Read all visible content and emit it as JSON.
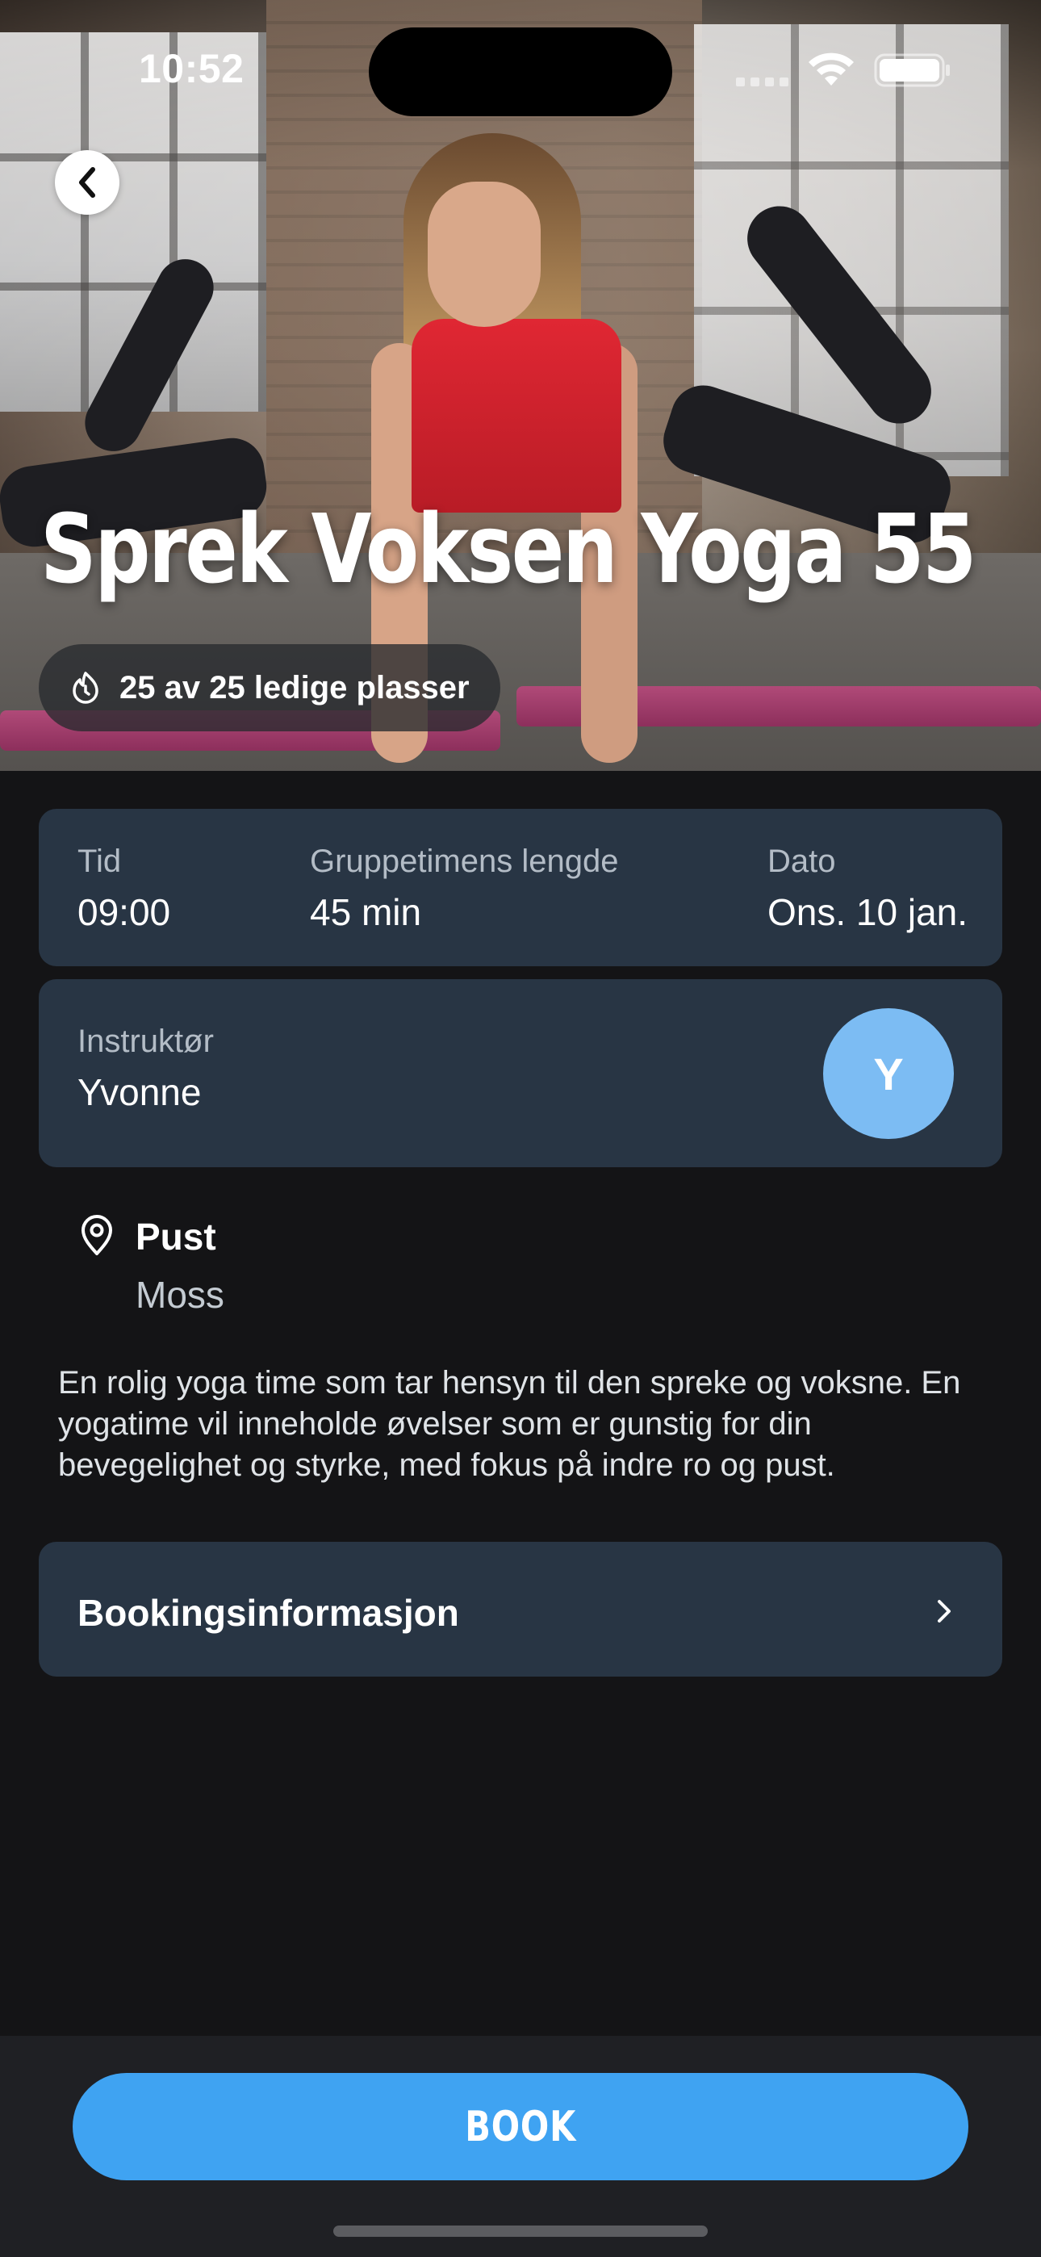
{
  "status_bar": {
    "time": "10:52"
  },
  "hero": {
    "title": "Sprek Voksen Yoga 55",
    "availability": "25 av 25 ledige plasser",
    "availability_icon": "flame-timer-icon"
  },
  "details": {
    "time_label": "Tid",
    "time_value": "09:00",
    "duration_label": "Gruppetimens lengde",
    "duration_value": "45 min",
    "date_label": "Dato",
    "date_value": "Ons. 10 jan."
  },
  "instructor": {
    "label": "Instruktør",
    "name": "Yvonne",
    "avatar_initial": "Y",
    "avatar_color": "#7cbcf3"
  },
  "location": {
    "icon": "location-pin-icon",
    "name": "Pust",
    "city": "Moss"
  },
  "description": "En rolig yoga time som tar hensyn til den spreke og voksne. En yogatime vil inneholde øvelser som er gunstig for din bevegelighet og styrke, med fokus på indre ro og pust.",
  "booking_info": {
    "label": "Bookingsinformasjon"
  },
  "actions": {
    "book_label": "BOOK",
    "accent_color": "#3fa3f2"
  },
  "colors": {
    "background": "#141416",
    "card": "#283544"
  }
}
